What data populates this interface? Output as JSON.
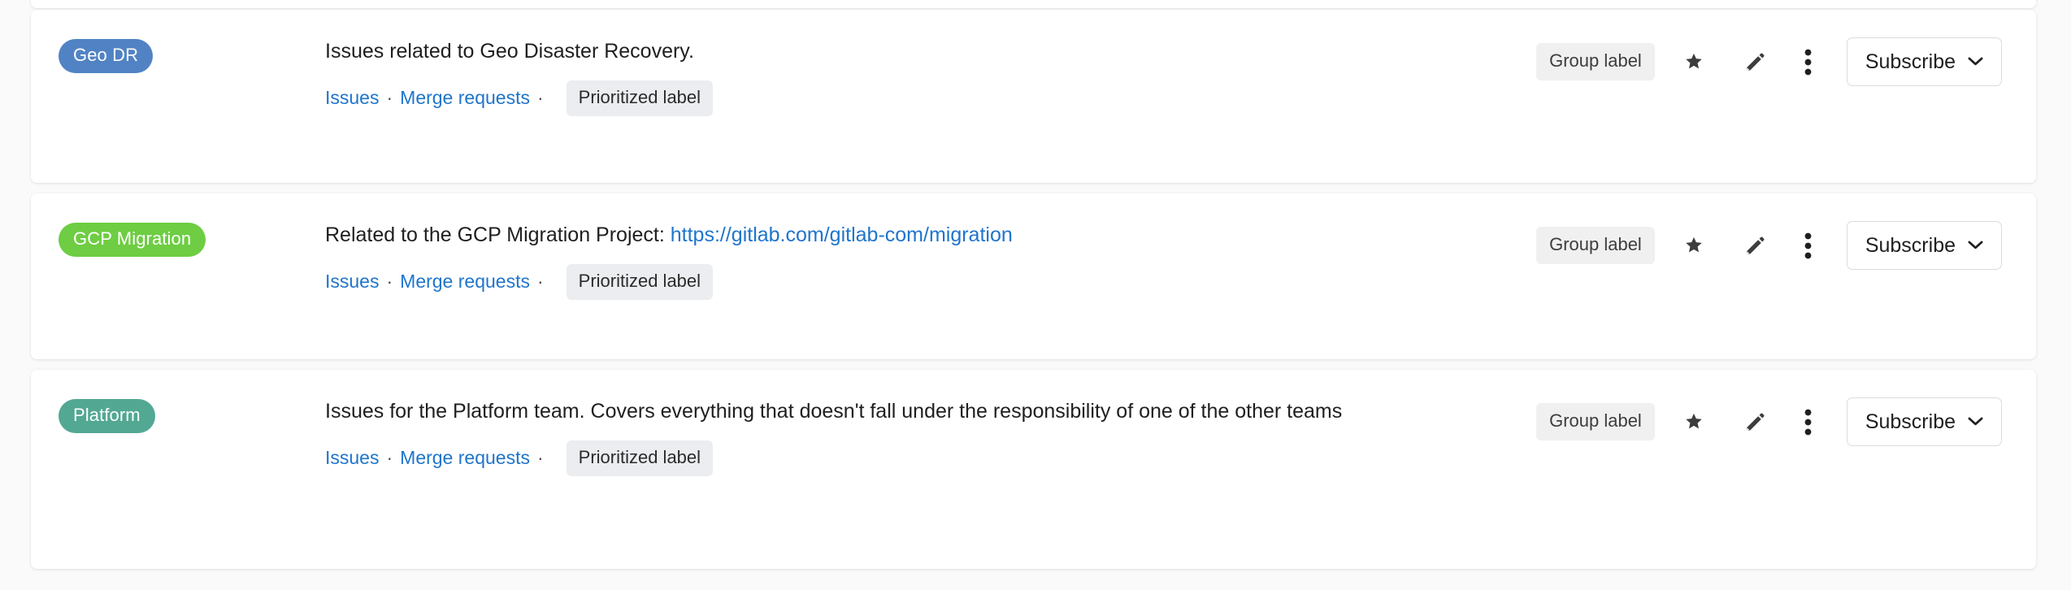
{
  "page": {
    "background_color": "#fafafa",
    "card_background": "#ffffff",
    "link_color": "#1f75cb",
    "text_color": "#1f1f1f"
  },
  "labels": [
    {
      "name": "Geo DR",
      "color": "#5183c4",
      "description": "Issues related to Geo Disaster Recovery.",
      "description_link_text": "",
      "description_link_url": "",
      "issues_label": "Issues",
      "merge_requests_label": "Merge requests",
      "separator": "·",
      "prioritized_label": "Prioritized label",
      "scope_badge": "Group label",
      "subscribe_label": "Subscribe"
    },
    {
      "name": "GCP Migration",
      "color": "#6ecd43",
      "description": "Related to the GCP Migration Project: ",
      "description_link_text": "https://gitlab.com/gitlab-com/migration",
      "description_link_url": "https://gitlab.com/gitlab-com/migration",
      "issues_label": "Issues",
      "merge_requests_label": "Merge requests",
      "separator": "·",
      "prioritized_label": "Prioritized label",
      "scope_badge": "Group label",
      "subscribe_label": "Subscribe"
    },
    {
      "name": "Platform",
      "color": "#52a893",
      "description": "Issues for the Platform team. Covers everything that doesn't fall under the responsibility of one of the other teams",
      "description_link_text": "",
      "description_link_url": "",
      "issues_label": "Issues",
      "merge_requests_label": "Merge requests",
      "separator": "·",
      "prioritized_label": "Prioritized label",
      "scope_badge": "Group label",
      "subscribe_label": "Subscribe"
    }
  ],
  "icons": {
    "star": "star-icon",
    "edit": "pencil-icon",
    "more": "kebab-menu-icon",
    "caret": "chevron-down-icon"
  }
}
